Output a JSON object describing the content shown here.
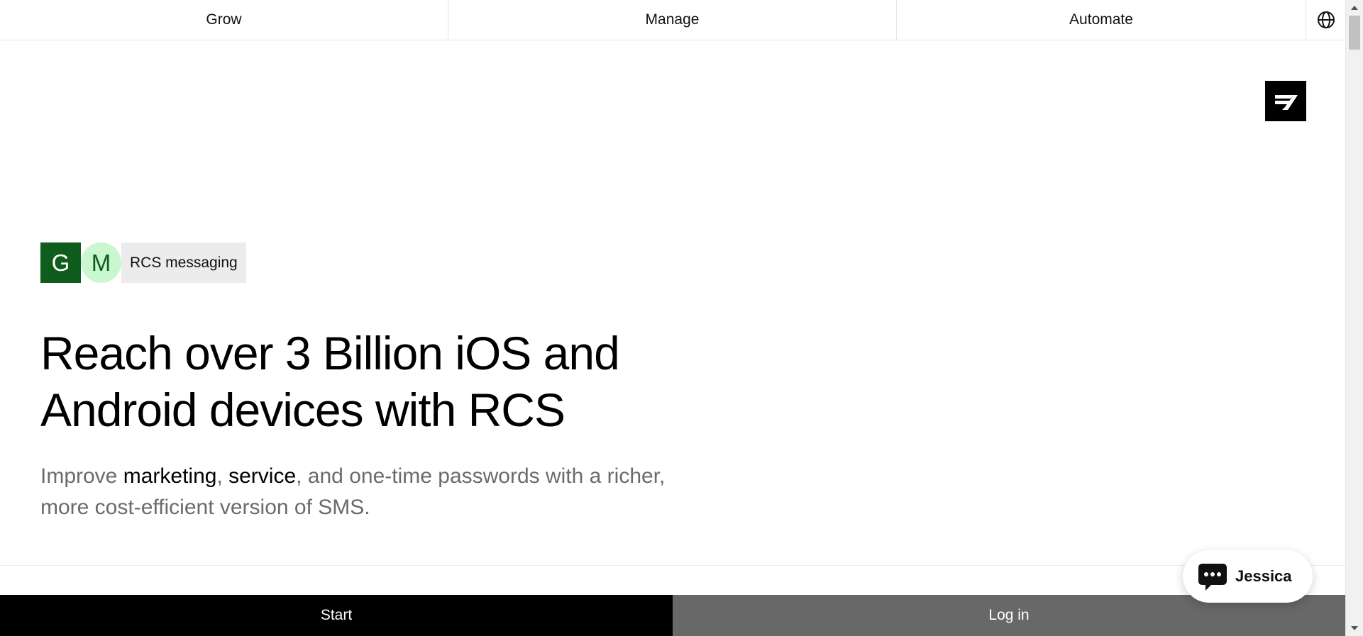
{
  "nav": {
    "items": [
      {
        "label": "Grow"
      },
      {
        "label": "Manage"
      },
      {
        "label": "Automate"
      }
    ],
    "globe_icon": "globe-icon"
  },
  "logo": {
    "icon": "brand-logo-icon",
    "color": "#000000"
  },
  "badges": {
    "g": "G",
    "m": "M",
    "label": "RCS messaging",
    "g_color": "#0f5d1c",
    "m_color": "#c9f7cf"
  },
  "hero": {
    "title_line1": "Reach over 3 Billion iOS and",
    "title_line2": "Android devices with RCS",
    "sub_part1": "Improve ",
    "sub_marketing": "marketing",
    "sub_part2": ", ",
    "sub_service": "service",
    "sub_part3": ", and one-time passwords with a richer,",
    "sub_line2": "more cost-efficient version of SMS."
  },
  "cta": {
    "start_label": "Start",
    "login_label": "Log in",
    "start_color": "#000000",
    "login_color": "#686868"
  },
  "chat": {
    "name": "Jessica",
    "icon": "chat-bubble-icon"
  }
}
